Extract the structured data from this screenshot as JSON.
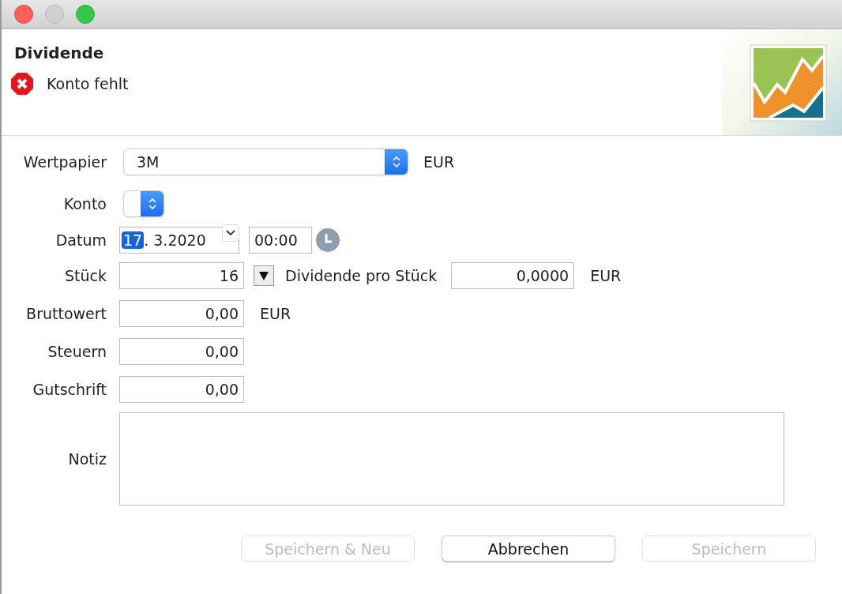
{
  "header": {
    "title": "Dividende",
    "error": "Konto fehlt"
  },
  "security": {
    "label": "Wertpapier",
    "value": "3M",
    "currency": "EUR"
  },
  "account": {
    "label": "Konto"
  },
  "date": {
    "label": "Datum",
    "day": "17",
    "rest": ". 3.2020",
    "time": "00:00"
  },
  "shares": {
    "label": "Stück",
    "value": "16",
    "per_share_label": "Dividende pro Stück",
    "per_share_value": "0,0000",
    "currency": "EUR"
  },
  "amounts": [
    {
      "label": "Bruttowert",
      "value": "0,00",
      "currency": "EUR"
    },
    {
      "label": "Steuern",
      "value": "0,00"
    },
    {
      "label": "Gutschrift",
      "value": "0,00"
    }
  ],
  "note": {
    "label": "Notiz"
  },
  "buttons": [
    {
      "label": "Speichern & Neu",
      "disabled": true
    },
    {
      "label": "Abbrechen",
      "disabled": false
    },
    {
      "label": "Speichern",
      "disabled": true
    }
  ]
}
